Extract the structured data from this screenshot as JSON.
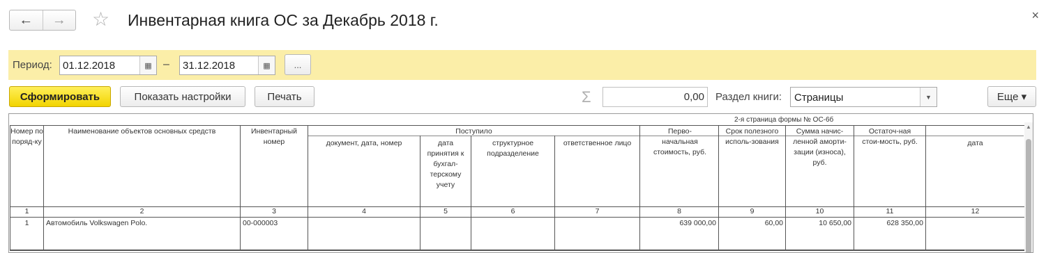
{
  "header": {
    "back_icon": "←",
    "forward_icon": "→",
    "favorite_icon": "☆",
    "title": "Инвентарная книга ОС за Декабрь 2018 г.",
    "close_icon": "×"
  },
  "period": {
    "label": "Период:",
    "start": "01.12.2018",
    "separator": "–",
    "end": "31.12.2018",
    "more_label": "..."
  },
  "toolbar": {
    "generate_label": "Сформировать",
    "settings_label": "Показать настройки",
    "print_label": "Печать",
    "sigma_icon": "Σ",
    "sum_value": "0,00",
    "section_label": "Раздел книги:",
    "section_value": "Страницы",
    "more_label": "Еще ▾"
  },
  "report": {
    "caption": "2-я страница формы № ОС-6б",
    "group_received": "Поступило",
    "headers": {
      "c1": "Номер по поряд-ку",
      "c2": "Наименование объектов основных средств",
      "c3": "Инвентарный номер",
      "c4": "документ, дата, номер",
      "c5": "дата принятия к бухгал-терскому учету",
      "c6": "структурное подразделение",
      "c7": "ответственное лицо",
      "c8": "Перво-начальная стоимость, руб.",
      "c9": "Срок полезного исполь-зования",
      "c10": "Сумма начис-ленной аморти-зации (износа), руб.",
      "c11": "Остаточ-ная стои-мость, руб.",
      "c12": "дата"
    },
    "numbers": [
      "1",
      "2",
      "3",
      "4",
      "5",
      "6",
      "7",
      "8",
      "9",
      "10",
      "11",
      "12"
    ],
    "rows": [
      {
        "num": "1",
        "name": "Автомобиль Volkswagen Polo.",
        "inv": "00-000003",
        "cost": "639 000,00",
        "term": "60,00",
        "amort": "10 650,00",
        "residual": "628 350,00"
      }
    ]
  }
}
